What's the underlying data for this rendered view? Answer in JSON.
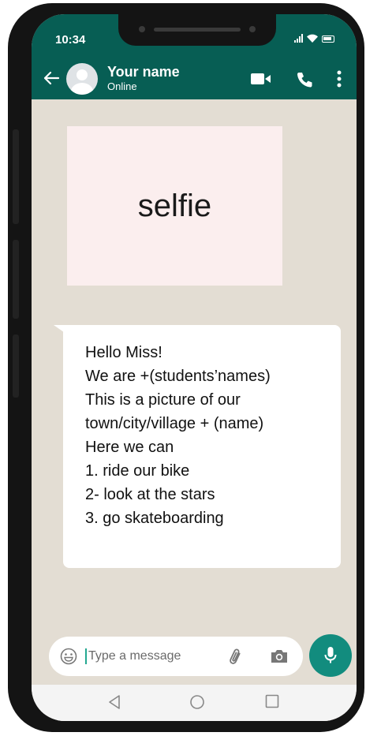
{
  "status_bar": {
    "time": "10:34"
  },
  "header": {
    "contact_name": "Your name",
    "contact_status": "Online",
    "icons": [
      "back-arrow-icon",
      "avatar",
      "video-call-icon",
      "phone-call-icon",
      "more-options-icon"
    ],
    "color": "#075e54"
  },
  "messages": {
    "image_placeholder": "selfie",
    "text_lines": [
      "Hello Miss!",
      "We are +(students’names)",
      "This is a picture of our",
      "town/city/village + (name)",
      "Here we can",
      "1. ride our bike",
      "2- look at the stars",
      "3. go skateboarding"
    ]
  },
  "composer": {
    "placeholder": "Type a message",
    "icons": [
      "emoji-icon",
      "attach-icon",
      "camera-icon",
      "mic-icon"
    ],
    "mic_color": "#128c7e"
  },
  "nav_bar": {
    "buttons": [
      "nav-back-icon",
      "nav-home-icon",
      "nav-recents-icon"
    ]
  }
}
